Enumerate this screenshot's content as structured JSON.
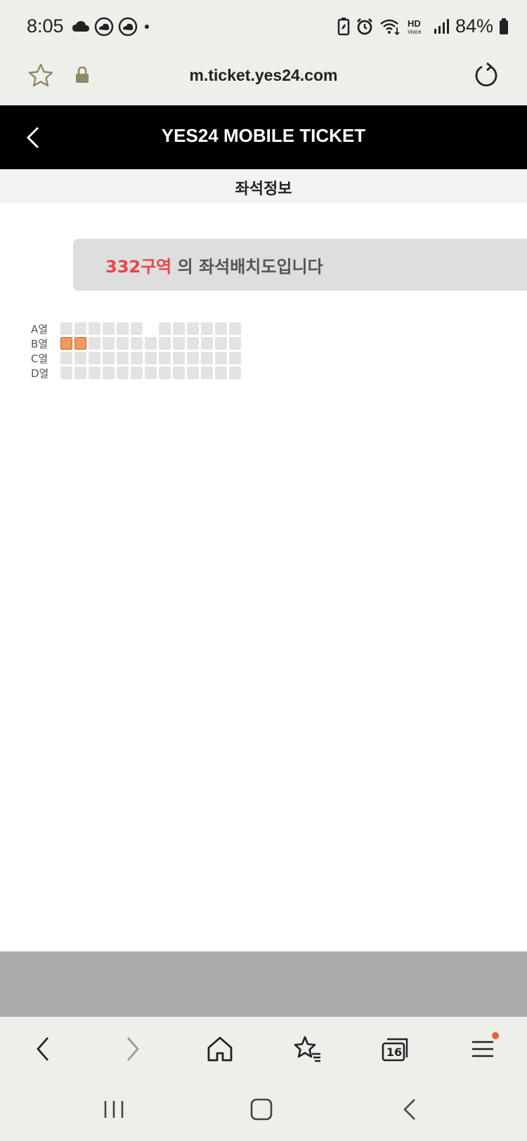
{
  "status_bar": {
    "time": "8:05",
    "battery": "84%",
    "icons": [
      "cloud-icon",
      "weather-icon",
      "weather-icon",
      "dot-icon",
      "battery-saver-icon",
      "alarm-icon",
      "wifi-icon",
      "hd-voice-icon",
      "signal-icon",
      "battery-icon"
    ]
  },
  "browser": {
    "url": "m.ticket.yes24.com"
  },
  "header": {
    "title": "YES24 MOBILE TICKET"
  },
  "section": {
    "title": "좌석정보"
  },
  "notice": {
    "zone": "332구역",
    "suffix": " 의 좌석배치도입니다"
  },
  "seat_map": {
    "rows": [
      {
        "label": "A열",
        "seats": [
          0,
          0,
          0,
          0,
          0,
          0,
          "gap",
          0,
          0,
          0,
          0,
          0,
          0
        ]
      },
      {
        "label": "B열",
        "seats": [
          1,
          1,
          0,
          0,
          0,
          0,
          0,
          0,
          0,
          0,
          0,
          0,
          0
        ]
      },
      {
        "label": "C열",
        "seats": [
          0,
          0,
          0,
          0,
          0,
          0,
          0,
          0,
          0,
          0,
          0,
          0,
          0
        ]
      },
      {
        "label": "D열",
        "seats": [
          0,
          0,
          0,
          0,
          0,
          0,
          0,
          0,
          0,
          0,
          0,
          0,
          0
        ]
      }
    ],
    "colors": {
      "available": "#e3e3e3",
      "selected": "#f09a5b",
      "accent": "#e8454c"
    }
  },
  "toolbar": {
    "tab_count": "16"
  }
}
